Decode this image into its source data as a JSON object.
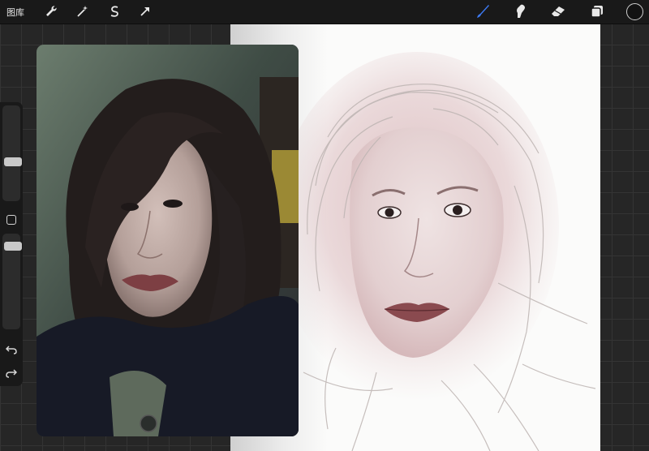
{
  "toolbar": {
    "gallery_label": "图库",
    "left_tools": [
      {
        "name": "actions",
        "icon": "wrench-icon"
      },
      {
        "name": "adjustments",
        "icon": "magic-wand-icon"
      },
      {
        "name": "selection",
        "icon": "selection-s-icon"
      },
      {
        "name": "transform",
        "icon": "arrow-cursor-icon"
      }
    ],
    "right_tools": [
      {
        "name": "brush",
        "icon": "brush-icon",
        "active": true,
        "color": "#3d7bf5"
      },
      {
        "name": "smudge",
        "icon": "smudge-icon",
        "active": false
      },
      {
        "name": "eraser",
        "icon": "eraser-icon",
        "active": false
      },
      {
        "name": "layers",
        "icon": "layers-icon",
        "active": false
      }
    ],
    "current_color": "#121212"
  },
  "sidebar": {
    "brush_size_level": 0.62,
    "opacity_level": 0.96,
    "modify_icon": "square-icon",
    "undo_icon": "undo-icon",
    "redo_icon": "redo-icon"
  },
  "canvas": {
    "background": "#fbfbfa",
    "reference_image": "reference-photo-portrait",
    "artwork": "pencil-sketch-portrait"
  }
}
